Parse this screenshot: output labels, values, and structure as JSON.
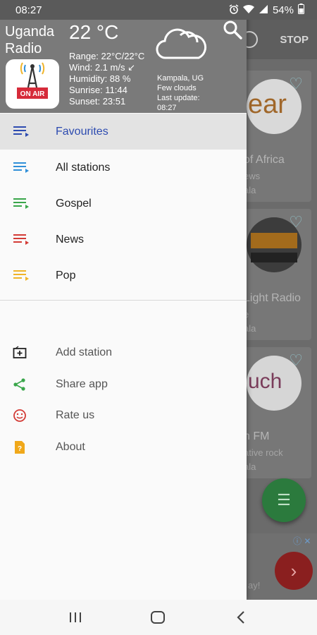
{
  "status_bar": {
    "time": "08:27",
    "battery": "54%",
    "icons": [
      "alarm-icon",
      "wifi-icon",
      "signal-icon",
      "battery-icon"
    ]
  },
  "header": {
    "app_name": "Uganda Radio",
    "logo_text": "ON AIR",
    "temperature": "22 °C",
    "range": "Range: 22°C/22°C",
    "wind": "Wind: 2.1 m/s ↙",
    "humidity": "Humidity: 88 %",
    "sunrise": "Sunrise: 11:44",
    "sunset": "Sunset: 23:51",
    "location": "Kampala, UG",
    "condition": "Few clouds",
    "last_update_label": "Last update:",
    "last_update_time": "08:27",
    "weather_icon": "cloud-icon",
    "search_icon": "search-icon"
  },
  "menu": {
    "categories": [
      {
        "label": "Favourites",
        "color": "#2d4bb0",
        "selected": true
      },
      {
        "label": "All stations",
        "color": "#2f8fd8",
        "selected": false
      },
      {
        "label": "Gospel",
        "color": "#3aa64b",
        "selected": false
      },
      {
        "label": "News",
        "color": "#d33b36",
        "selected": false
      },
      {
        "label": "Pop",
        "color": "#f0b429",
        "selected": false
      }
    ],
    "actions": [
      {
        "label": "Add station",
        "icon": "add-station-icon",
        "color": "#222222"
      },
      {
        "label": "Share app",
        "icon": "share-icon",
        "color": "#3aa64b"
      },
      {
        "label": "Rate us",
        "icon": "smiley-icon",
        "color": "#d33b36"
      },
      {
        "label": "About",
        "icon": "about-icon",
        "color": "#f0a81a"
      }
    ]
  },
  "background": {
    "stop_label": "STOP",
    "stations": [
      {
        "name": "of Africa",
        "sub": "ews",
        "loc": "ala"
      },
      {
        "name": "Light Radio",
        "sub": "e",
        "loc": "ala"
      },
      {
        "name": "h FM",
        "sub": "ative rock",
        "loc": "ala"
      }
    ],
    "ad_text": "ay!"
  },
  "nav_bar": {
    "icons": [
      "recent-apps-icon",
      "home-icon",
      "back-icon"
    ]
  }
}
